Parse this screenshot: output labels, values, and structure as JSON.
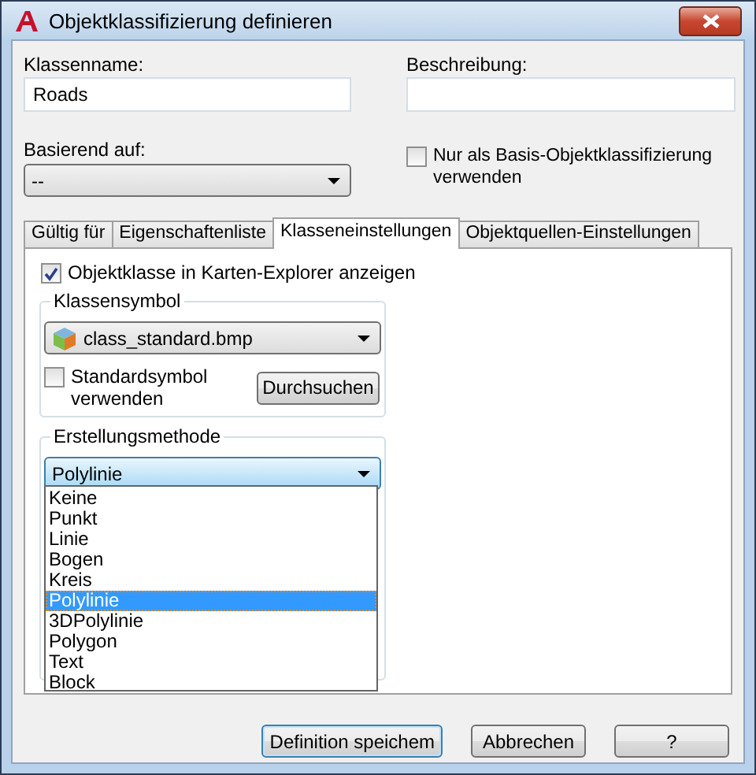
{
  "window": {
    "title": "Objektklassifizierung definieren"
  },
  "name_field": {
    "label": "Klassenname:",
    "value": "Roads"
  },
  "description_field": {
    "label": "Beschreibung:"
  },
  "based_on": {
    "label": "Basierend auf:",
    "value": "--"
  },
  "base_only": {
    "label": "Nur als Basis-Objektklassifizierung verwenden",
    "checked": false
  },
  "tabs": [
    {
      "label": "Gültig für",
      "selected": false
    },
    {
      "label": "Eigenschaftenliste",
      "selected": false
    },
    {
      "label": "Klasseneinstellungen",
      "selected": true
    },
    {
      "label": "Objektquellen-Einstellungen",
      "selected": false
    }
  ],
  "show_in_explorer": {
    "label": "Objektklasse in Karten-Explorer anzeigen",
    "checked": true
  },
  "class_symbol": {
    "title": "Klassensymbol",
    "value": "class_standard.bmp",
    "use_default": {
      "label": "Standardsymbol verwenden",
      "checked": false
    },
    "browse_button": "Durchsuchen"
  },
  "creation_method": {
    "title": "Erstellungsmethode",
    "value": "Polylinie",
    "expanded": true,
    "options": [
      {
        "label": "Keine",
        "selected": false
      },
      {
        "label": "Punkt",
        "selected": false
      },
      {
        "label": "Linie",
        "selected": false
      },
      {
        "label": "Bogen",
        "selected": false
      },
      {
        "label": "Kreis",
        "selected": false
      },
      {
        "label": "Polylinie",
        "selected": true
      },
      {
        "label": "3DPolylinie",
        "selected": false
      },
      {
        "label": "Polygon",
        "selected": false
      },
      {
        "label": "Text",
        "selected": false
      },
      {
        "label": "Block",
        "selected": false
      }
    ]
  },
  "buttons": [
    {
      "label": "Definition speichem",
      "default": true
    },
    {
      "label": "Abbrechen",
      "default": false
    },
    {
      "label": "?",
      "default": false
    }
  ]
}
